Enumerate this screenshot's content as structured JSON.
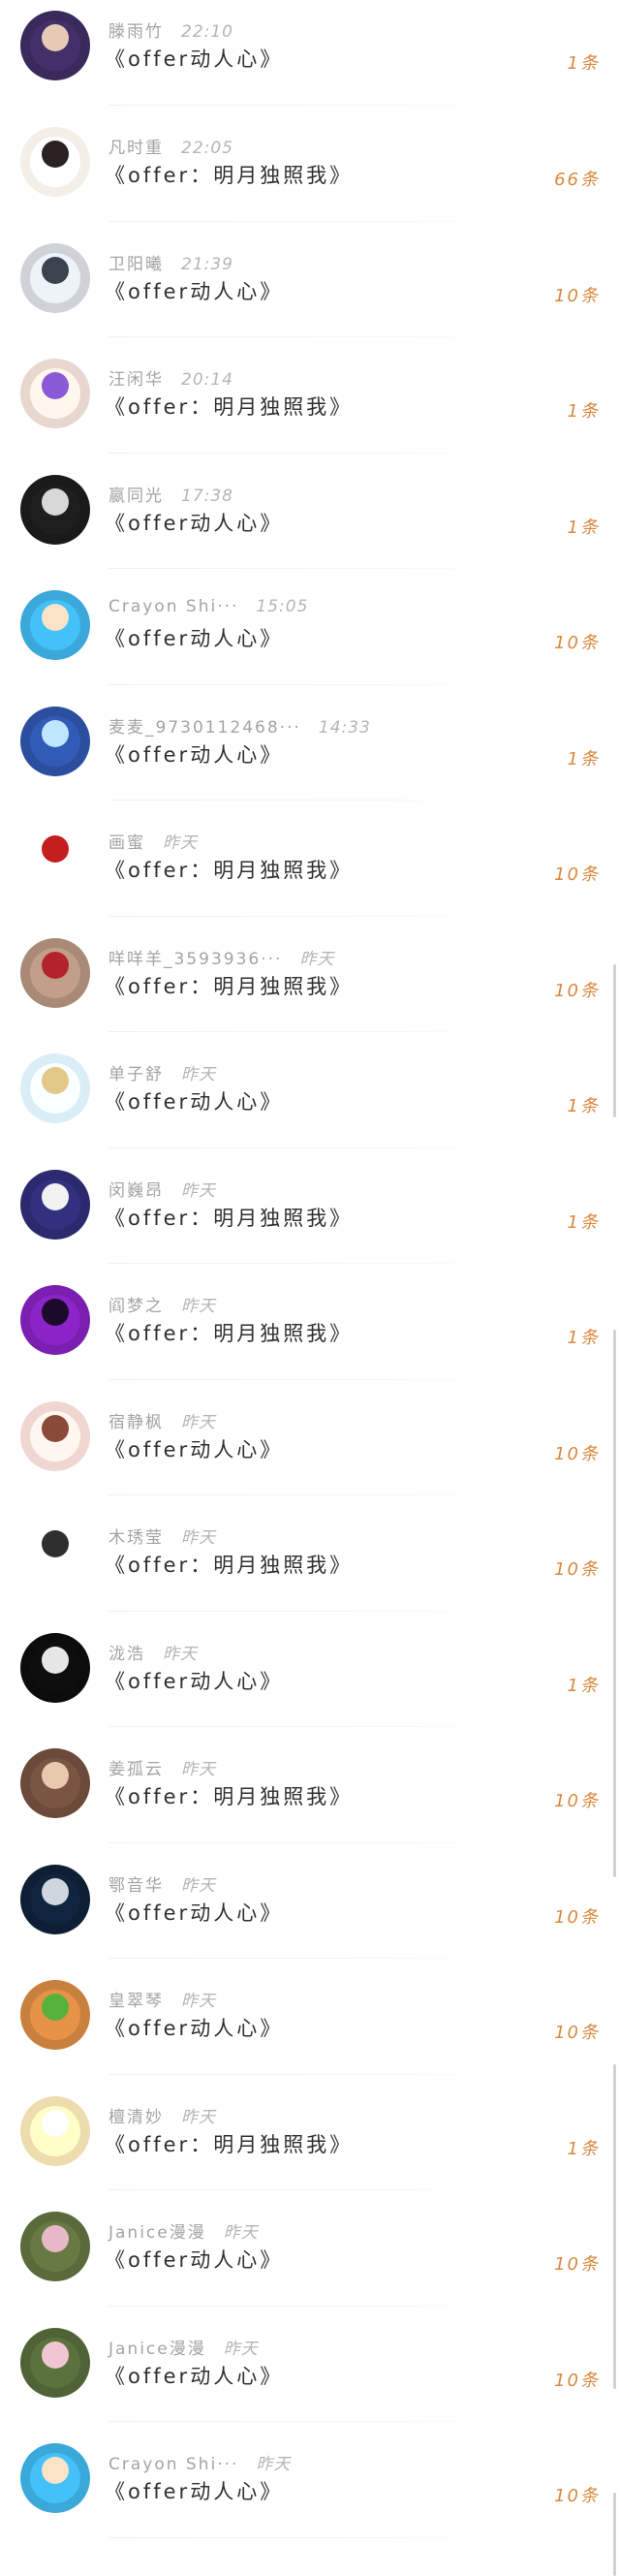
{
  "messages": [
    {
      "name": "滕雨竹",
      "time": "22:10",
      "title": "《offer动人心》",
      "count": "1条",
      "avatar": {
        "bg": "#3a2a5c",
        "accent": "#e8c9b6"
      }
    },
    {
      "name": "凡时重",
      "time": "22:05",
      "title": "《offer：明月独照我》",
      "count": "66条",
      "avatar": {
        "bg": "#f3efe8",
        "accent": "#2a2222"
      }
    },
    {
      "name": "卫阳曦",
      "time": "21:39",
      "title": "《offer动人心》",
      "count": "10条",
      "avatar": {
        "bg": "#cfd3d8",
        "accent": "#3b4350"
      }
    },
    {
      "name": "汪闲华",
      "time": "20:14",
      "title": "《offer：明月独照我》",
      "count": "1条",
      "avatar": {
        "bg": "#e7d7cf",
        "accent": "#8b5ad6"
      }
    },
    {
      "name": "嬴同光",
      "time": "17:38",
      "title": "《offer动人心》",
      "count": "1条",
      "avatar": {
        "bg": "#1a1a1a",
        "accent": "#d8d8d8"
      }
    },
    {
      "name": "Crayon Shi···",
      "time": "15:05",
      "title": "《offer动人心》",
      "count": "10条",
      "avatar": {
        "bg": "#3aa8d8",
        "accent": "#fbe3c8"
      }
    },
    {
      "name": "麦麦_9730112468···",
      "time": "14:33",
      "title": "《offer动人心》",
      "count": "1条",
      "avatar": {
        "bg": "#2b4f9e",
        "accent": "#bfe6ff"
      }
    },
    {
      "name": "画蜜",
      "time": "昨天",
      "title": "《offer：明月独照我》",
      "count": "10条",
      "avatar": {
        "bg": "#ffffff",
        "accent": "#c41f1f"
      }
    },
    {
      "name": "咩咩羊_3593936···",
      "time": "昨天",
      "title": "《offer：明月独照我》",
      "count": "10条",
      "avatar": {
        "bg": "#a88a76",
        "accent": "#b3232e"
      }
    },
    {
      "name": "单子舒",
      "time": "昨天",
      "title": "《offer动人心》",
      "count": "1条",
      "avatar": {
        "bg": "#d9eef6",
        "accent": "#e2c98a"
      }
    },
    {
      "name": "闵巍昂",
      "time": "昨天",
      "title": "《offer：明月独照我》",
      "count": "1条",
      "avatar": {
        "bg": "#2c2a6e",
        "accent": "#f2f2f2"
      }
    },
    {
      "name": "阎梦之",
      "time": "昨天",
      "title": "《offer：明月独照我》",
      "count": "1条",
      "avatar": {
        "bg": "#7a1fb0",
        "accent": "#1b0a2a"
      }
    },
    {
      "name": "宿静枫",
      "time": "昨天",
      "title": "《offer动人心》",
      "count": "10条",
      "avatar": {
        "bg": "#f0d6d0",
        "accent": "#8a4a3a"
      }
    },
    {
      "name": "木琇莹",
      "time": "昨天",
      "title": "《offer：明月独照我》",
      "count": "10条",
      "avatar": {
        "bg": "#ffffff",
        "accent": "#2f2f2f"
      }
    },
    {
      "name": "泷浩",
      "time": "昨天",
      "title": "《offer动人心》",
      "count": "1条",
      "avatar": {
        "bg": "#0c0c0c",
        "accent": "#e6e6e6"
      }
    },
    {
      "name": "姜孤云",
      "time": "昨天",
      "title": "《offer：明月独照我》",
      "count": "10条",
      "avatar": {
        "bg": "#6b4a3a",
        "accent": "#e9c8b0"
      }
    },
    {
      "name": "鄂音华",
      "time": "昨天",
      "title": "《offer动人心》",
      "count": "10条",
      "avatar": {
        "bg": "#0e1f35",
        "accent": "#cfd6e0"
      }
    },
    {
      "name": "皇翠琴",
      "time": "昨天",
      "title": "《offer动人心》",
      "count": "10条",
      "avatar": {
        "bg": "#c9803e",
        "accent": "#56b23b"
      }
    },
    {
      "name": "檀清妙",
      "time": "昨天",
      "title": "《offer：明月独照我》",
      "count": "1条",
      "avatar": {
        "bg": "#ecdcae",
        "accent": "#ffffff"
      }
    },
    {
      "name": "Janice漫漫",
      "time": "昨天",
      "title": "《offer动人心》",
      "count": "10条",
      "avatar": {
        "bg": "#5a6a3a",
        "accent": "#e7b9c8"
      }
    },
    {
      "name": "Janice漫漫",
      "time": "昨天",
      "title": "《offer动人心》",
      "count": "10条",
      "avatar": {
        "bg": "#4f6336",
        "accent": "#f1c6d2"
      }
    },
    {
      "name": "Crayon Shi···",
      "time": "昨天",
      "title": "《offer动人心》",
      "count": "10条",
      "avatar": {
        "bg": "#3aa8d8",
        "accent": "#fbe3c8"
      }
    }
  ]
}
